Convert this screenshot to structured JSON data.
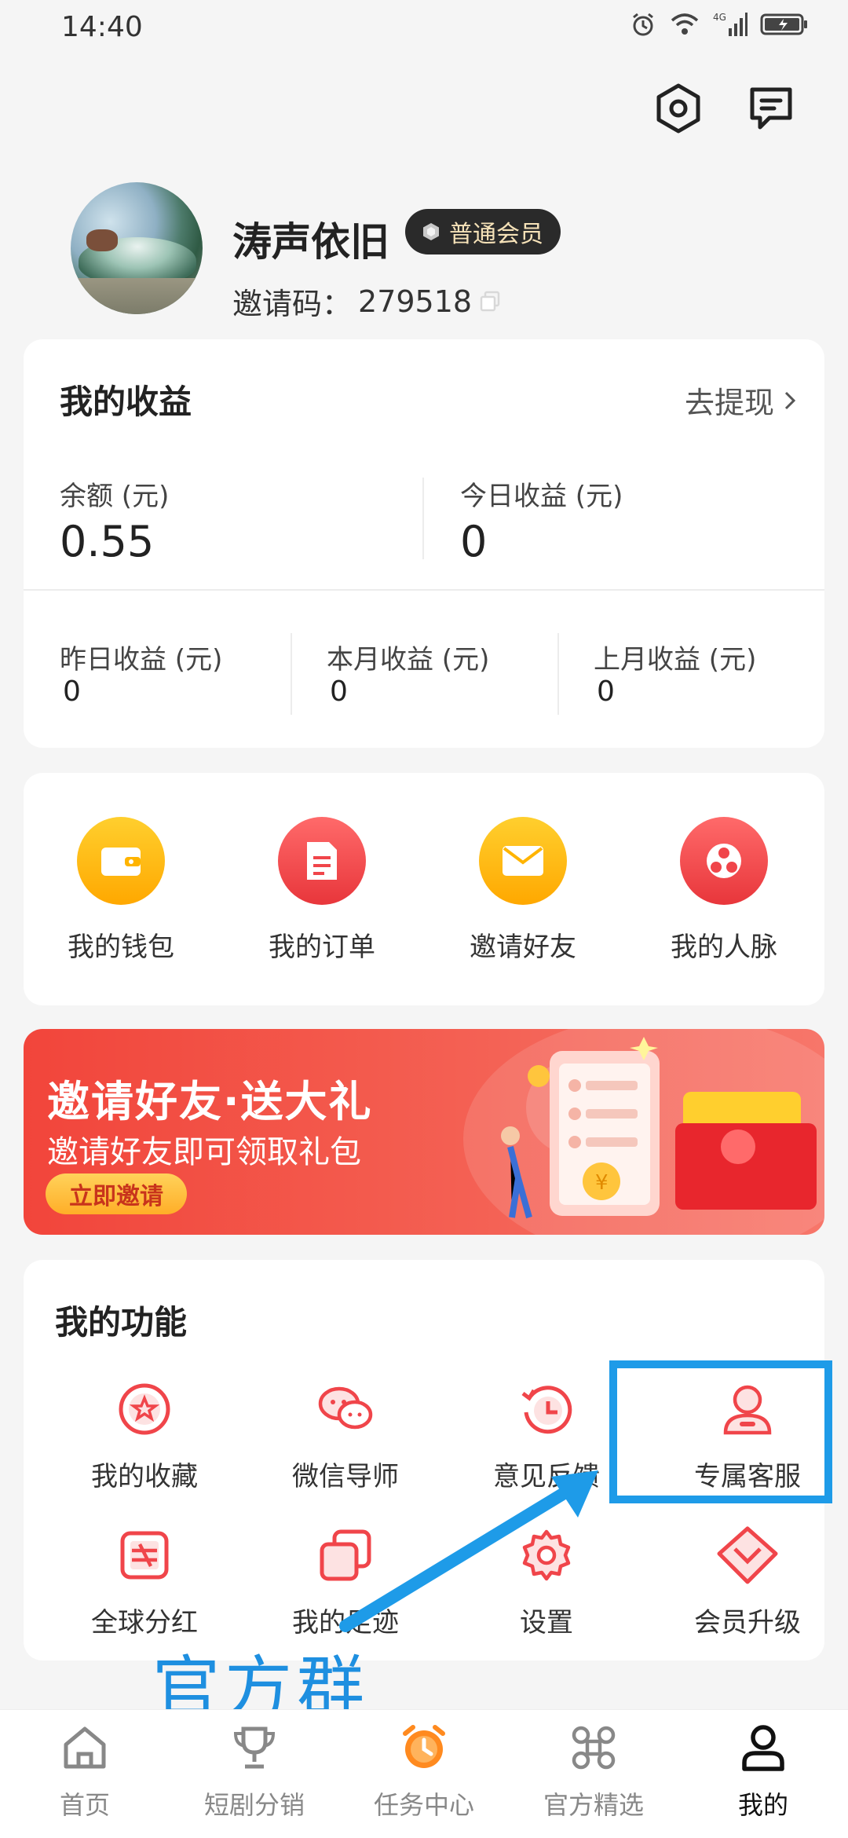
{
  "status_bar": {
    "time": "14:40",
    "network": "4G"
  },
  "profile": {
    "username": "涛声依旧",
    "member_badge": "普通会员",
    "invite_label": "邀请码：",
    "invite_code": "279518"
  },
  "earnings": {
    "title": "我的收益",
    "withdraw_label": "去提现",
    "balance": {
      "label": "余额 (元)",
      "value": "0.55"
    },
    "today": {
      "label": "今日收益 (元)",
      "value": "0"
    },
    "yesterday": {
      "label": "昨日收益 (元)",
      "value": "0"
    },
    "this_month": {
      "label": "本月收益 (元)",
      "value": "0"
    },
    "last_month": {
      "label": "上月收益 (元)",
      "value": "0"
    }
  },
  "quick_actions": [
    {
      "label": "我的钱包",
      "icon": "wallet-icon",
      "color": "#ffb400"
    },
    {
      "label": "我的订单",
      "icon": "order-icon",
      "color": "#f0454a"
    },
    {
      "label": "邀请好友",
      "icon": "envelope-icon",
      "color": "#ffb400"
    },
    {
      "label": "我的人脉",
      "icon": "network-icon",
      "color": "#f0454a"
    }
  ],
  "banner": {
    "title": "邀请好友·送大礼",
    "subtitle": "邀请好友即可领取礼包",
    "button": "立即邀请"
  },
  "functions": {
    "title": "我的功能",
    "items": [
      {
        "label": "我的收藏",
        "icon": "favorite-star-icon"
      },
      {
        "label": "微信导师",
        "icon": "wechat-icon"
      },
      {
        "label": "意见反馈",
        "icon": "feedback-clock-icon"
      },
      {
        "label": "专属客服",
        "icon": "customer-service-icon"
      },
      {
        "label": "全球分红",
        "icon": "dividend-icon"
      },
      {
        "label": "我的足迹",
        "icon": "footprint-icon"
      },
      {
        "label": "设置",
        "icon": "settings-gear-icon"
      },
      {
        "label": "会员升级",
        "icon": "upgrade-chevron-icon"
      }
    ]
  },
  "annotation": {
    "text": "官方群"
  },
  "bottom_nav": [
    {
      "label": "首页",
      "icon": "home-icon"
    },
    {
      "label": "短剧分销",
      "icon": "trophy-icon"
    },
    {
      "label": "任务中心",
      "icon": "alarm-clock-icon"
    },
    {
      "label": "官方精选",
      "icon": "command-icon"
    },
    {
      "label": "我的",
      "icon": "person-icon",
      "active": true
    }
  ],
  "colors": {
    "accent_red": "#f0454a",
    "accent_yellow": "#ffb400",
    "annotation_blue": "#1e9be8"
  }
}
